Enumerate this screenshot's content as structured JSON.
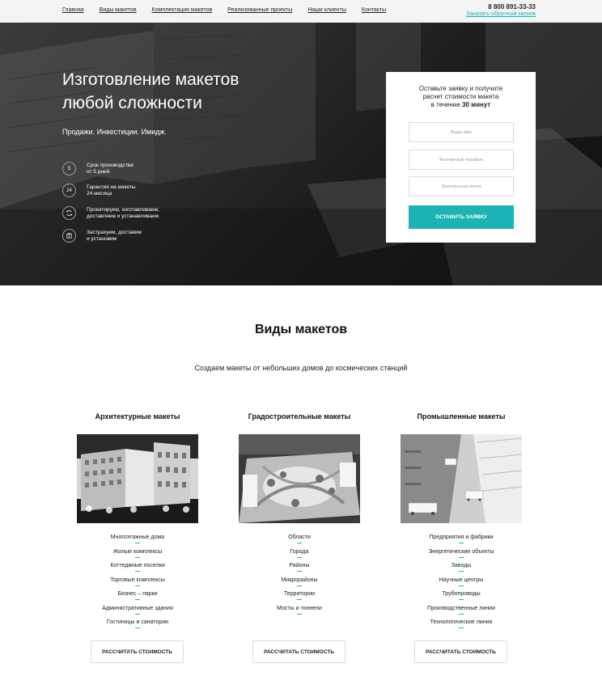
{
  "nav": {
    "items": [
      "Главная",
      "Виды макетов",
      "Комплектация макетов",
      "Реализованные проекты",
      "Наши клиенты",
      "Контакты"
    ],
    "phone": "8 800 891-33-33",
    "callback": "Заказать обратный звонок"
  },
  "hero": {
    "title_line1": "Изготовление макетов",
    "title_line2": "любой сложности",
    "tagline": "Продажи. Инвестиции. Имидж.",
    "features": [
      {
        "badge": "5",
        "line1": "Срок производства",
        "line2": "от 5 дней"
      },
      {
        "badge": "24",
        "line1": "Гарантия на макеты",
        "line2": "24 месяца"
      },
      {
        "icon": "refresh-icon",
        "line1": "Проектируем, изготавливаем,",
        "line2": "доставляем и устанавливаем"
      },
      {
        "icon": "package-icon",
        "line1": "Застрахуем, доставим",
        "line2": "и установим"
      }
    ]
  },
  "form": {
    "title_line1": "Оставьте заявку и получите",
    "title_line2": "расчет стоимости макета",
    "title_line3_prefix": "в течение ",
    "title_line3_bold": "30 минут",
    "name_placeholder": "Ваше имя",
    "phone_placeholder": "Контактный телефон",
    "email_placeholder": "Электронная почта",
    "submit": "ОСТАВИТЬ ЗАЯВКУ"
  },
  "section": {
    "title": "Виды макетов",
    "subtitle": "Создаем макеты от небольших домов до космических станций"
  },
  "columns": [
    {
      "title": "Архитектурные макеты",
      "items": [
        "Многоэтажные дома",
        "Жилые комплексы",
        "Коттеджные поселки",
        "Торговые комплексы",
        "Бизнес – парки",
        "Административные здания",
        "Гостиницы и санатории"
      ],
      "button": "РАССЧИТАТЬ СТОИМОСТЬ"
    },
    {
      "title": "Градостроительные макеты",
      "items": [
        "Области",
        "Города",
        "Районы",
        "Микрорайоны",
        "Территории",
        "Мосты и тоннели"
      ],
      "button": "РАССЧИТАТЬ СТОИМОСТЬ"
    },
    {
      "title": "Промышленные макеты",
      "items": [
        "Предприятия и фабрики",
        "Энергетические объекты",
        "Заводы",
        "Научные центры",
        "Трубопроводы",
        "Производственные линии",
        "Технологические линии"
      ],
      "button": "РАССЧИТАТЬ СТОИМОСТЬ"
    }
  ],
  "colors": {
    "accent": "#1bb3b3",
    "hero_dark": "#1c1c1c"
  }
}
